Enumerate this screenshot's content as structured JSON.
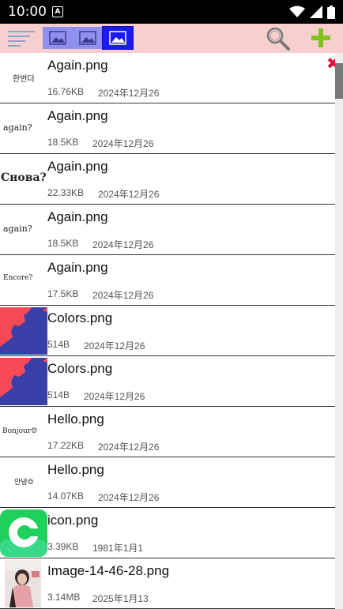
{
  "status_bar": {
    "time": "10:00",
    "notification_icon": "a-box-icon",
    "wifi_icon": "wifi-icon",
    "signal_icon": "signal-icon",
    "battery_icon": "battery-icon"
  },
  "toolbar": {
    "menu_icon": "sort-lines-icon",
    "view_modes": [
      "image-view-icon",
      "image-view-icon",
      "image-view-icon"
    ],
    "active_view_index": 2,
    "search_icon": "search-icon",
    "add_icon": "plus-icon",
    "background": "#f7cfcf",
    "add_color": "#7ec21b"
  },
  "close_icon": "close-x-icon",
  "files": [
    {
      "name": "Again.png",
      "size": "16.76KB",
      "date": "2024年12月26",
      "thumb_text": "한번더"
    },
    {
      "name": "Again.png",
      "size": "18.5KB",
      "date": "2024年12月26",
      "thumb_text": "again?"
    },
    {
      "name": "Again.png",
      "size": "22.33KB",
      "date": "2024年12月26",
      "thumb_text": "Снова?"
    },
    {
      "name": "Again.png",
      "size": "18.5KB",
      "date": "2024年12月26",
      "thumb_text": "again?"
    },
    {
      "name": "Again.png",
      "size": "17.5KB",
      "date": "2024年12月26",
      "thumb_text": "Encore?"
    },
    {
      "name": "Colors.png",
      "size": "514B",
      "date": "2024年12月26"
    },
    {
      "name": "Colors.png",
      "size": "514B",
      "date": "2024年12月26"
    },
    {
      "name": "Hello.png",
      "size": "17.22KB",
      "date": "2024年12月26",
      "thumb_text": "Bonjour☺"
    },
    {
      "name": "Hello.png",
      "size": "14.07KB",
      "date": "2024年12月26",
      "thumb_text": "안녕☺"
    },
    {
      "name": "icon.png",
      "size": "3.39KB",
      "date": "1981年1月1"
    },
    {
      "name": "Image-14-46-28.png",
      "size": "3.14MB",
      "date": "2025年1月13"
    }
  ]
}
